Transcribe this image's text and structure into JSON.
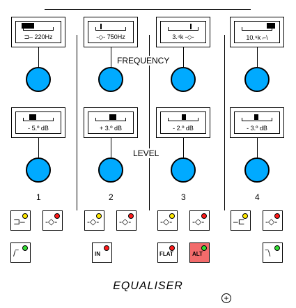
{
  "title": "EQUALISER",
  "sections": {
    "frequency": "FREQUENCY",
    "level": "LEVEL"
  },
  "channels": [
    {
      "number": "1",
      "frequency": "220Hz",
      "level": "- 5.º  dB"
    },
    {
      "number": "2",
      "frequency": "750Hz",
      "level": "+ 3.º  dB"
    },
    {
      "number": "3",
      "frequency": "3.⁴k",
      "level": "- 2.º  dB"
    },
    {
      "number": "4",
      "frequency": "10.⁹k",
      "level": "- 3.º  dB"
    }
  ],
  "mode_buttons": {
    "in": "IN",
    "flat": "FLAT",
    "alt": "ALT"
  },
  "icons": {
    "low_shelf": "low-shelf-icon",
    "peak": "peak-icon",
    "high_shelf": "high-shelf-icon",
    "high_pass": "high-pass-icon",
    "low_pass": "low-pass-icon",
    "add": "plus-circle-icon"
  },
  "colors": {
    "knob": "#00aaff",
    "led_yellow": "#ffe800",
    "led_red": "#ff1a1a",
    "led_green": "#33dd33",
    "alt_active": "#f26b6b"
  }
}
